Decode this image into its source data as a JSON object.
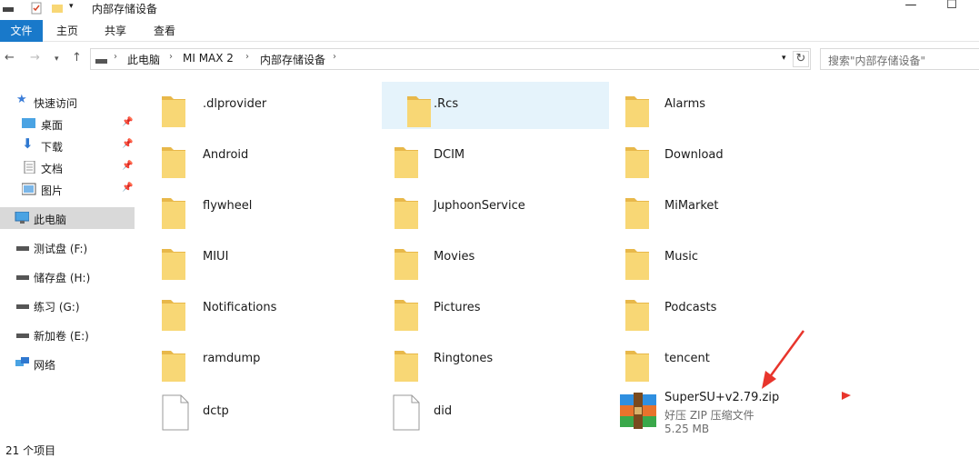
{
  "window": {
    "title": "内部存储设备",
    "minimize_glyph": "—",
    "maximize_glyph": "☐"
  },
  "ribbon": {
    "tabs": [
      "文件",
      "主页",
      "共享",
      "查看"
    ]
  },
  "address": {
    "crumbs": [
      "此电脑",
      "MI MAX 2",
      "内部存储设备"
    ],
    "search_placeholder": "搜索\"内部存储设备\""
  },
  "sidebar": {
    "quick_access": "快速访问",
    "pinned": [
      {
        "label": "桌面",
        "icon": "desktop-icon"
      },
      {
        "label": "下载",
        "icon": "download-arrow-icon"
      },
      {
        "label": "文档",
        "icon": "document-icon"
      },
      {
        "label": "图片",
        "icon": "picture-icon"
      }
    ],
    "this_pc": "此电脑",
    "drives": [
      "测试盘 (F:)",
      "储存盘 (H:)",
      "练习 (G:)",
      "新加卷 (E:)"
    ],
    "network": "网络"
  },
  "folders": [
    ".dlprovider",
    ".Rcs",
    "Alarms",
    "Android",
    "DCIM",
    "Download",
    "flywheel",
    "JuphoonService",
    "MiMarket",
    "MIUI",
    "Movies",
    "Music",
    "Notifications",
    "Pictures",
    "Podcasts",
    "ramdump",
    "Ringtones",
    "tencent"
  ],
  "files": [
    {
      "name": "dctp",
      "type": "file"
    },
    {
      "name": "did",
      "type": "file"
    }
  ],
  "zip": {
    "name": "SuperSU+v2.79.zip",
    "type_label": "好压 ZIP 压缩文件",
    "size": "5.25 MB"
  },
  "status": {
    "count": "21 个项目"
  },
  "colors": {
    "accent": "#1979ca",
    "folder": "#f8d775",
    "folder_dark": "#e8b84a",
    "hover": "#e5f3fb",
    "arrow": "#e8352c"
  }
}
